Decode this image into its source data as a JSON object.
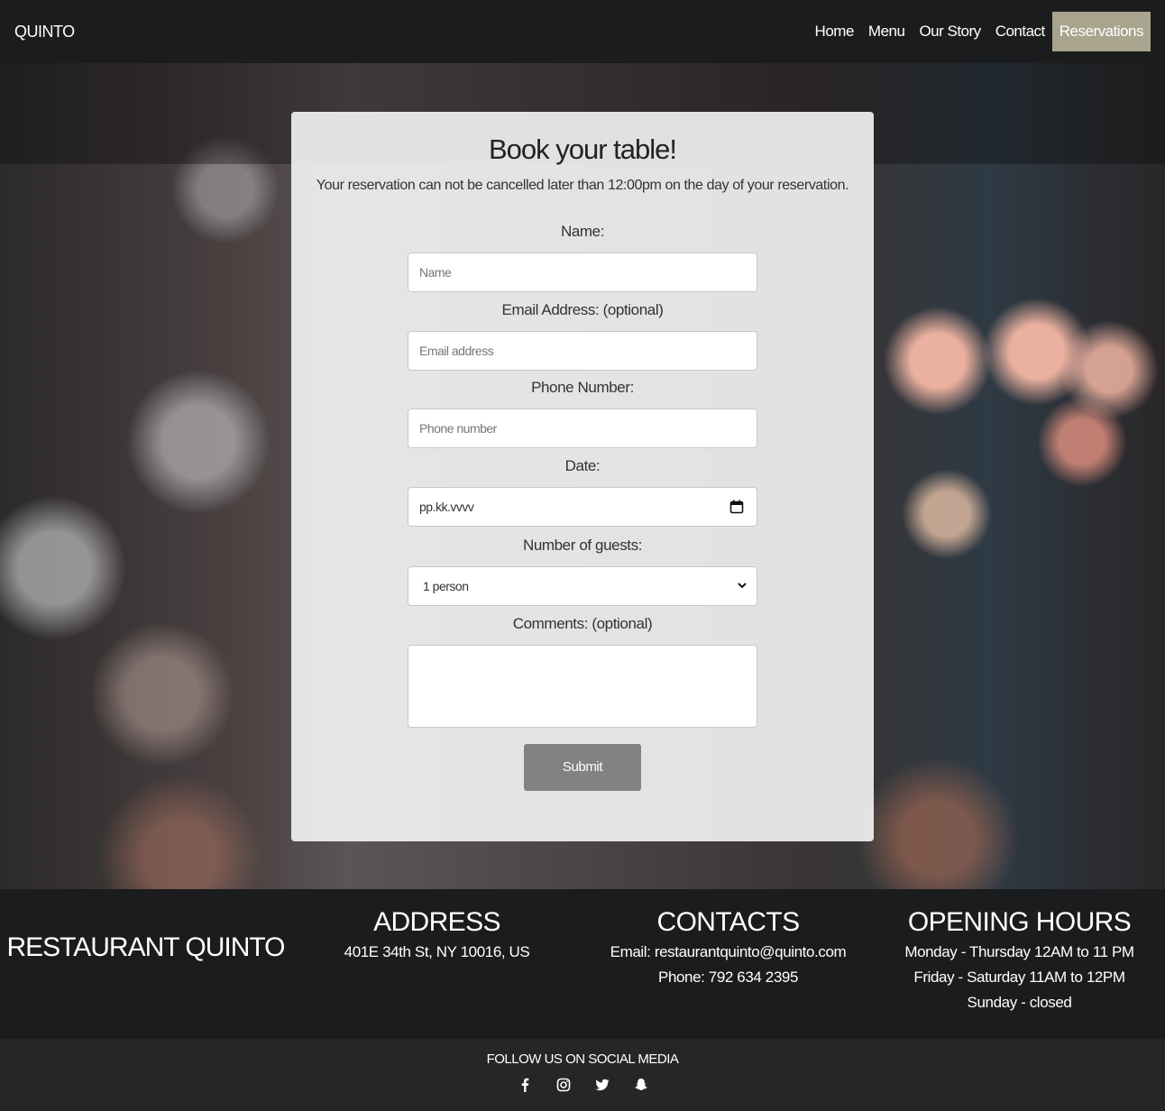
{
  "nav": {
    "brand": "QUINTO",
    "links": [
      {
        "label": "Home"
      },
      {
        "label": "Menu"
      },
      {
        "label": "Our Story"
      },
      {
        "label": "Contact"
      },
      {
        "label": "Reservations"
      }
    ],
    "active_color": "#a8a48e"
  },
  "form": {
    "title": "Book your table!",
    "subtitle": "Your reservation can not be cancelled later than 12:00pm on the day of your reservation.",
    "name_label": "Name:",
    "name_placeholder": "Name",
    "email_label": "Email Address: (optional)",
    "email_placeholder": "Email address",
    "phone_label": "Phone Number:",
    "phone_placeholder": "Phone number",
    "date_label": "Date:",
    "date_value": "pp.kk.vvvv",
    "guests_label": "Number of guests:",
    "guests_value": "1 person",
    "comments_label": "Comments: (optional)",
    "submit_label": "Submit"
  },
  "footer": {
    "brand": "RESTAURANT QUINTO",
    "address_heading": "ADDRESS",
    "address": "401E 34th St, NY 10016, US",
    "contacts_heading": "CONTACTS",
    "email": "Email: restaurantquinto@quinto.com",
    "phone": "Phone: 792 634 2395",
    "hours_heading": "OPENING HOURS",
    "hours": [
      "Monday - Thursday 12AM to 11 PM",
      "Friday - Saturday 11AM to 12PM",
      "Sunday - closed"
    ],
    "social_title": "FOLLOW US ON SOCIAL MEDIA",
    "social_icons": [
      "facebook-icon",
      "instagram-icon",
      "twitter-icon",
      "snapchat-icon"
    ]
  }
}
